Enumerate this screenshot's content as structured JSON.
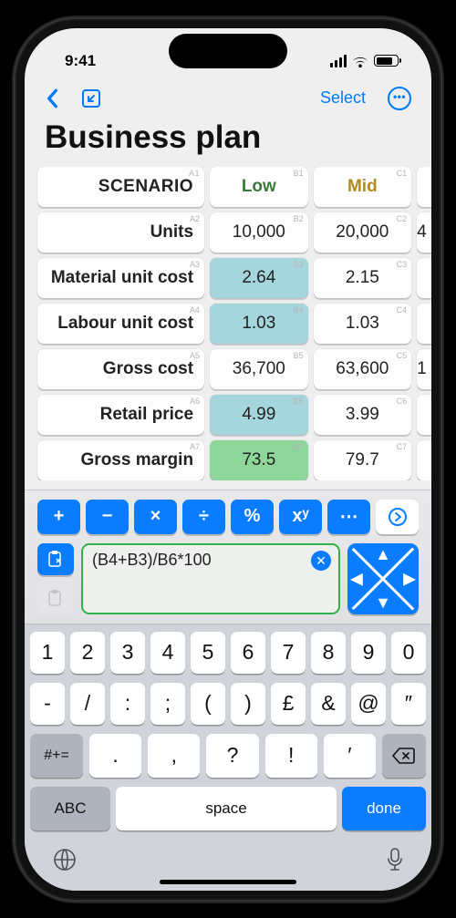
{
  "status": {
    "time": "9:41"
  },
  "nav": {
    "select": "Select"
  },
  "title": "Business plan",
  "sheet": {
    "header": {
      "label": "SCENARIO",
      "refA": "A1",
      "low": "Low",
      "refB": "B1",
      "mid": "Mid",
      "refC": "C1"
    },
    "rows": [
      {
        "label": "Units",
        "refA": "A2",
        "b": "10,000",
        "refB": "B2",
        "c": "20,000",
        "refC": "C2",
        "d": "4"
      },
      {
        "label": "Material unit cost",
        "refA": "A3",
        "b": "2.64",
        "refB": "B3",
        "c": "2.15",
        "refC": "C3",
        "d": ""
      },
      {
        "label": "Labour unit cost",
        "refA": "A4",
        "b": "1.03",
        "refB": "B4",
        "c": "1.03",
        "refC": "C4",
        "d": ""
      },
      {
        "label": "Gross cost",
        "refA": "A5",
        "b": "36,700",
        "refB": "B5",
        "c": "63,600",
        "refC": "C5",
        "d": "1"
      },
      {
        "label": "Retail price",
        "refA": "A6",
        "b": "4.99",
        "refB": "B6",
        "c": "3.99",
        "refC": "C6",
        "d": ""
      },
      {
        "label": "Gross margin",
        "refA": "A7",
        "b": "73.5",
        "refB": "B7",
        "c": "79.7",
        "refC": "C7",
        "d": ""
      }
    ]
  },
  "ops": {
    "plus": "+",
    "minus": "−",
    "times": "×",
    "div": "÷",
    "pct": "%",
    "pow": "xʸ",
    "more": "⋯",
    "advance": "⦿"
  },
  "formula": {
    "text": "(B4+B3)/B6*100"
  },
  "keyboard": {
    "row1": [
      "1",
      "2",
      "3",
      "4",
      "5",
      "6",
      "7",
      "8",
      "9",
      "0"
    ],
    "row2": [
      "-",
      "/",
      ":",
      ";",
      "(",
      ")",
      "£",
      "&",
      "@",
      "″"
    ],
    "row3": {
      "switch": "#+=",
      "keys": [
        ".",
        ",",
        "?",
        "!",
        "′"
      ]
    },
    "row4": {
      "abc": "ABC",
      "space": "space",
      "done": "done"
    }
  }
}
